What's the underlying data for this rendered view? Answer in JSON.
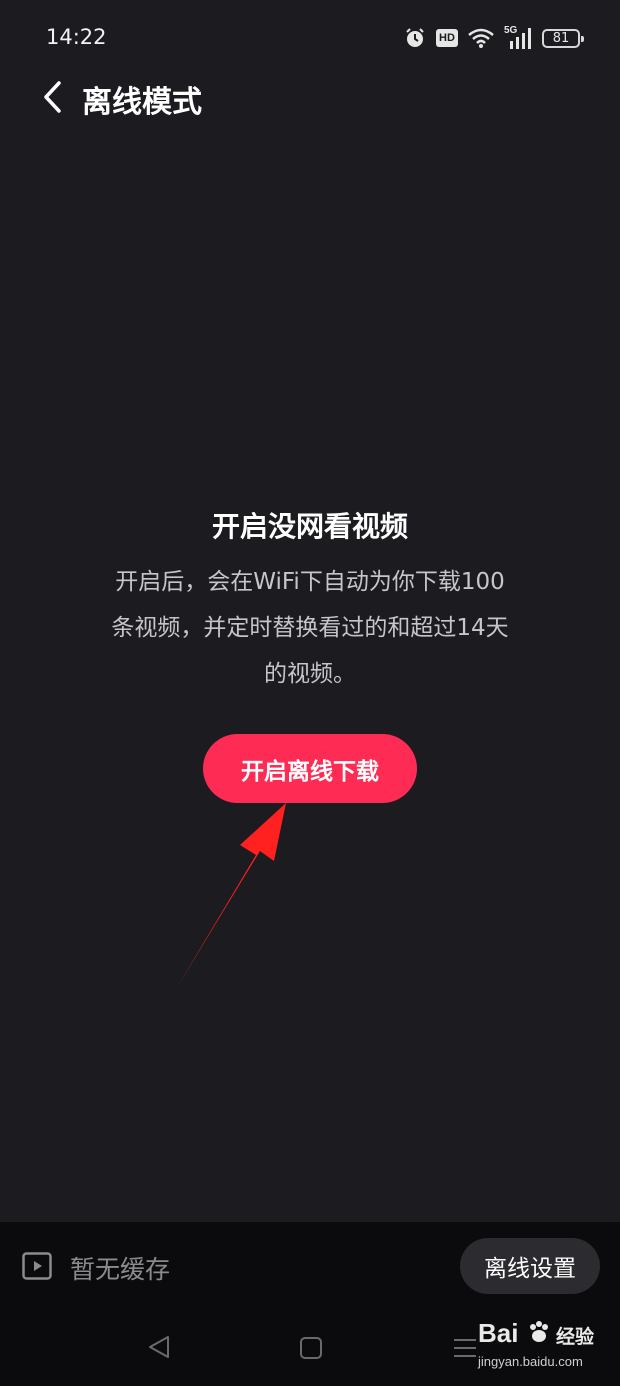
{
  "status_bar": {
    "time": "14:22",
    "hd_badge": "HD",
    "network": "5G",
    "battery": "81",
    "icons": [
      "alarm-icon",
      "hd-icon",
      "wifi-icon",
      "signal-5g-icon",
      "battery-icon"
    ]
  },
  "header": {
    "title": "离线模式",
    "back_icon": "chevron-left-icon"
  },
  "content": {
    "title": "开启没网看视频",
    "description_lines": [
      "开启后，会在WiFi下自动为你下载100",
      "条视频，并定时替换看过的和超过14天",
      "的视频。"
    ],
    "primary_button": "开启离线下载"
  },
  "bottom_bar": {
    "cache_icon": "video-play-icon",
    "cache_label": "暂无缓存",
    "settings_button": "离线设置"
  },
  "system_nav": {
    "icons": [
      "triangle-back-icon",
      "square-home-icon",
      "menu-recent-icon"
    ]
  },
  "watermark": {
    "logo": "Bai",
    "suffix": "经验",
    "url": "jingyan.baidu.com"
  },
  "colors": {
    "background": "#1c1b20",
    "accent": "#fe2c55",
    "annotation_arrow": "#ff2020",
    "bottom_bar": "#0b0b0d"
  }
}
